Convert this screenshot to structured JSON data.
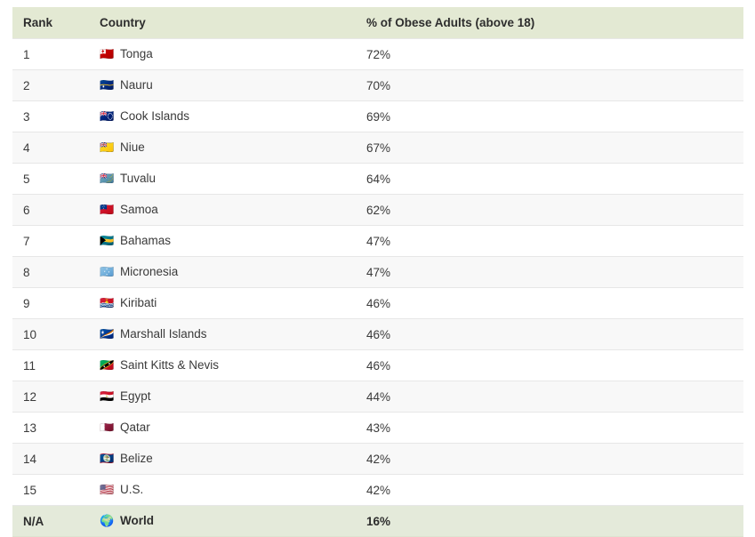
{
  "table": {
    "name": "obesity-by-country-table",
    "columns": [
      {
        "key": "rank",
        "label": "Rank"
      },
      {
        "key": "country",
        "label": "Country"
      },
      {
        "key": "pct",
        "label": "% of Obese Adults (above 18)"
      }
    ],
    "rows": [
      {
        "rank": "1",
        "flag": "🇹🇴",
        "flag_name": "flag-tonga",
        "country": "Tonga",
        "pct": "72%"
      },
      {
        "rank": "2",
        "flag": "🇳🇷",
        "flag_name": "flag-nauru",
        "country": "Nauru",
        "pct": "70%"
      },
      {
        "rank": "3",
        "flag": "🇨🇰",
        "flag_name": "flag-cook-islands",
        "country": "Cook Islands",
        "pct": "69%"
      },
      {
        "rank": "4",
        "flag": "🇳🇺",
        "flag_name": "flag-niue",
        "country": "Niue",
        "pct": "67%"
      },
      {
        "rank": "5",
        "flag": "🇹🇻",
        "flag_name": "flag-tuvalu",
        "country": "Tuvalu",
        "pct": "64%"
      },
      {
        "rank": "6",
        "flag": "🇼🇸",
        "flag_name": "flag-samoa",
        "country": "Samoa",
        "pct": "62%"
      },
      {
        "rank": "7",
        "flag": "🇧🇸",
        "flag_name": "flag-bahamas",
        "country": "Bahamas",
        "pct": "47%"
      },
      {
        "rank": "8",
        "flag": "🇫🇲",
        "flag_name": "flag-micronesia",
        "country": "Micronesia",
        "pct": "47%"
      },
      {
        "rank": "9",
        "flag": "🇰🇮",
        "flag_name": "flag-kiribati",
        "country": "Kiribati",
        "pct": "46%"
      },
      {
        "rank": "10",
        "flag": "🇲🇭",
        "flag_name": "flag-marshall-islands",
        "country": "Marshall Islands",
        "pct": "46%"
      },
      {
        "rank": "11",
        "flag": "🇰🇳",
        "flag_name": "flag-saint-kitts-nevis",
        "country": "Saint Kitts & Nevis",
        "pct": "46%"
      },
      {
        "rank": "12",
        "flag": "🇪🇬",
        "flag_name": "flag-egypt",
        "country": "Egypt",
        "pct": "44%"
      },
      {
        "rank": "13",
        "flag": "🇶🇦",
        "flag_name": "flag-qatar",
        "country": "Qatar",
        "pct": "43%"
      },
      {
        "rank": "14",
        "flag": "🇧🇿",
        "flag_name": "flag-belize",
        "country": "Belize",
        "pct": "42%"
      },
      {
        "rank": "15",
        "flag": "🇺🇸",
        "flag_name": "flag-us",
        "country": "U.S.",
        "pct": "42%"
      },
      {
        "rank": "N/A",
        "flag": "🌍",
        "flag_name": "globe-icon",
        "country": "World",
        "pct": "16%",
        "total": true
      }
    ]
  },
  "colors": {
    "header_background": "#e3e9d3",
    "total_row_background": "#e4eada",
    "row_odd_background": "#ffffff",
    "row_even_background": "#f8f8f8",
    "row_border": "#e7e7e7",
    "text": "#333333"
  }
}
